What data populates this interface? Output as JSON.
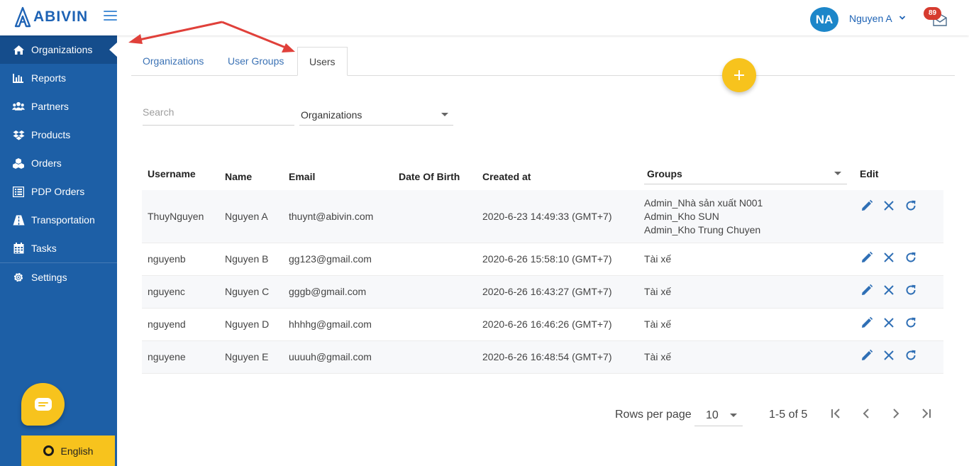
{
  "app": {
    "logo_text": "ABIVIN"
  },
  "header": {
    "avatar_initials": "NA",
    "user_name": "Nguyen A",
    "notification_count": "89"
  },
  "sidebar": {
    "items": [
      {
        "label": "Organizations",
        "icon": "home-icon",
        "active": true
      },
      {
        "label": "Reports",
        "icon": "chart-icon"
      },
      {
        "label": "Partners",
        "icon": "users-icon"
      },
      {
        "label": "Products",
        "icon": "dropbox-icon"
      },
      {
        "label": "Orders",
        "icon": "cubes-icon"
      },
      {
        "label": "PDP Orders",
        "icon": "list-icon"
      },
      {
        "label": "Transportation",
        "icon": "road-icon"
      },
      {
        "label": "Tasks",
        "icon": "calendar-icon"
      },
      {
        "label": "Settings",
        "icon": "gear-icon"
      }
    ],
    "language": "English"
  },
  "tabs": [
    {
      "label": "Organizations"
    },
    {
      "label": "User Groups"
    },
    {
      "label": "Users",
      "active": true
    }
  ],
  "filters": {
    "search_placeholder": "Search",
    "organization_select": "Organizations"
  },
  "table": {
    "headers": {
      "username": "Username",
      "name": "Name",
      "email": "Email",
      "dob": "Date Of Birth",
      "created": "Created at",
      "groups": "Groups",
      "edit": "Edit"
    },
    "rows": [
      {
        "username": "ThuyNguyen",
        "name": "Nguyen A",
        "email": "thuynt@abivin.com",
        "dob": "",
        "created": "2020-6-23 14:49:33 (GMT+7)",
        "groups": [
          "Admin_Nhà sản xuất N001",
          "Admin_Kho SUN",
          "Admin_Kho Trung Chuyen"
        ]
      },
      {
        "username": "nguyenb",
        "name": "Nguyen B",
        "email": "gg123@gmail.com",
        "dob": "",
        "created": "2020-6-26 15:58:10 (GMT+7)",
        "groups": [
          "Tài xế"
        ]
      },
      {
        "username": "nguyenc",
        "name": "Nguyen C",
        "email": "gggb@gmail.com",
        "dob": "",
        "created": "2020-6-26 16:43:27 (GMT+7)",
        "groups": [
          "Tài xế"
        ]
      },
      {
        "username": "nguyend",
        "name": "Nguyen D",
        "email": "hhhhg@gmail.com",
        "dob": "",
        "created": "2020-6-26 16:46:26 (GMT+7)",
        "groups": [
          "Tài xế"
        ]
      },
      {
        "username": "nguyene",
        "name": "Nguyen E",
        "email": "uuuuh@gmail.com",
        "dob": "",
        "created": "2020-6-26 16:48:54 (GMT+7)",
        "groups": [
          "Tài xế"
        ]
      }
    ]
  },
  "pagination": {
    "rows_per_page_label": "Rows per page",
    "rows_per_page": "10",
    "range": "1-5 of 5"
  },
  "colors": {
    "sidebar": "#1d5fa6",
    "brand_blue": "#1e63b5",
    "accent_yellow": "#f7c31d",
    "annotation_red": "#e0403a"
  }
}
